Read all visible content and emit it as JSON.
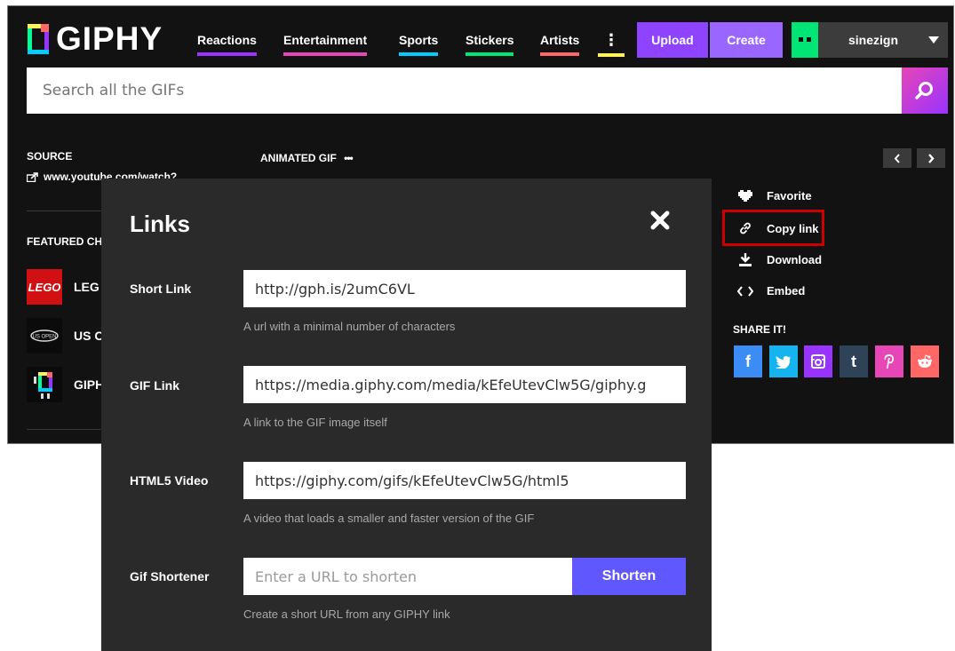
{
  "header": {
    "logo_text": "GIPHY",
    "nav": [
      {
        "label": "Reactions",
        "color": "#9933ff"
      },
      {
        "label": "Entertainment",
        "color": "#e646b6"
      },
      {
        "label": "Sports",
        "color": "#00ccff"
      },
      {
        "label": "Stickers",
        "color": "#00e676"
      },
      {
        "label": "Artists",
        "color": "#ff6666"
      }
    ],
    "more_accent": "#fff35c",
    "upload_label": "Upload",
    "create_label": "Create",
    "username": "sinezign",
    "avatar_glyph": "▪▪"
  },
  "search": {
    "placeholder": "Search all the GIFs"
  },
  "sidebar": {
    "source_label": "SOURCE",
    "source_link": "www.youtube.com/watch?",
    "featured_label": "FEATURED CH",
    "channels": [
      {
        "name": "LEG"
      },
      {
        "name": "US C"
      },
      {
        "name": "GIPH"
      }
    ]
  },
  "content": {
    "animated_label": "ANIMATED GIF",
    "more_glyph": "•••"
  },
  "pager": {
    "prev": "‹",
    "next": "›"
  },
  "actions": {
    "favorite": "Favorite",
    "copy_link": "Copy link",
    "download": "Download",
    "embed": "Embed",
    "share_label": "SHARE IT!"
  },
  "share": [
    {
      "icon": "facebook-icon",
      "glyph": "f",
      "color": "#3b8cf5"
    },
    {
      "icon": "twitter-icon",
      "glyph": "🐦",
      "color": "#15b4f0"
    },
    {
      "icon": "instagram-icon",
      "glyph": "◘",
      "color": "#9933ff"
    },
    {
      "icon": "tumblr-icon",
      "glyph": "t",
      "color": "#2e4358"
    },
    {
      "icon": "pinterest-icon",
      "glyph": "P",
      "color": "#e646b6"
    },
    {
      "icon": "reddit-icon",
      "glyph": "●",
      "color": "#ff6666"
    }
  ],
  "modal": {
    "title": "Links",
    "close_glyph": "✖",
    "rows": [
      {
        "label": "Short Link",
        "value": "http://gph.is/2umC6VL",
        "help": "A url with a minimal number of characters"
      },
      {
        "label": "GIF Link",
        "value": "https://media.giphy.com/media/kEfeUtevClw5G/giphy.g",
        "help": "A link to the GIF image itself"
      },
      {
        "label": "HTML5 Video",
        "value": "https://giphy.com/gifs/kEfeUtevClw5G/html5",
        "help": "A video that loads a smaller and faster version of the GIF"
      }
    ],
    "shortener": {
      "label": "Gif Shortener",
      "placeholder": "Enter a URL to shorten",
      "button": "Shorten",
      "help": "Create a short URL from any GIPHY link"
    }
  }
}
